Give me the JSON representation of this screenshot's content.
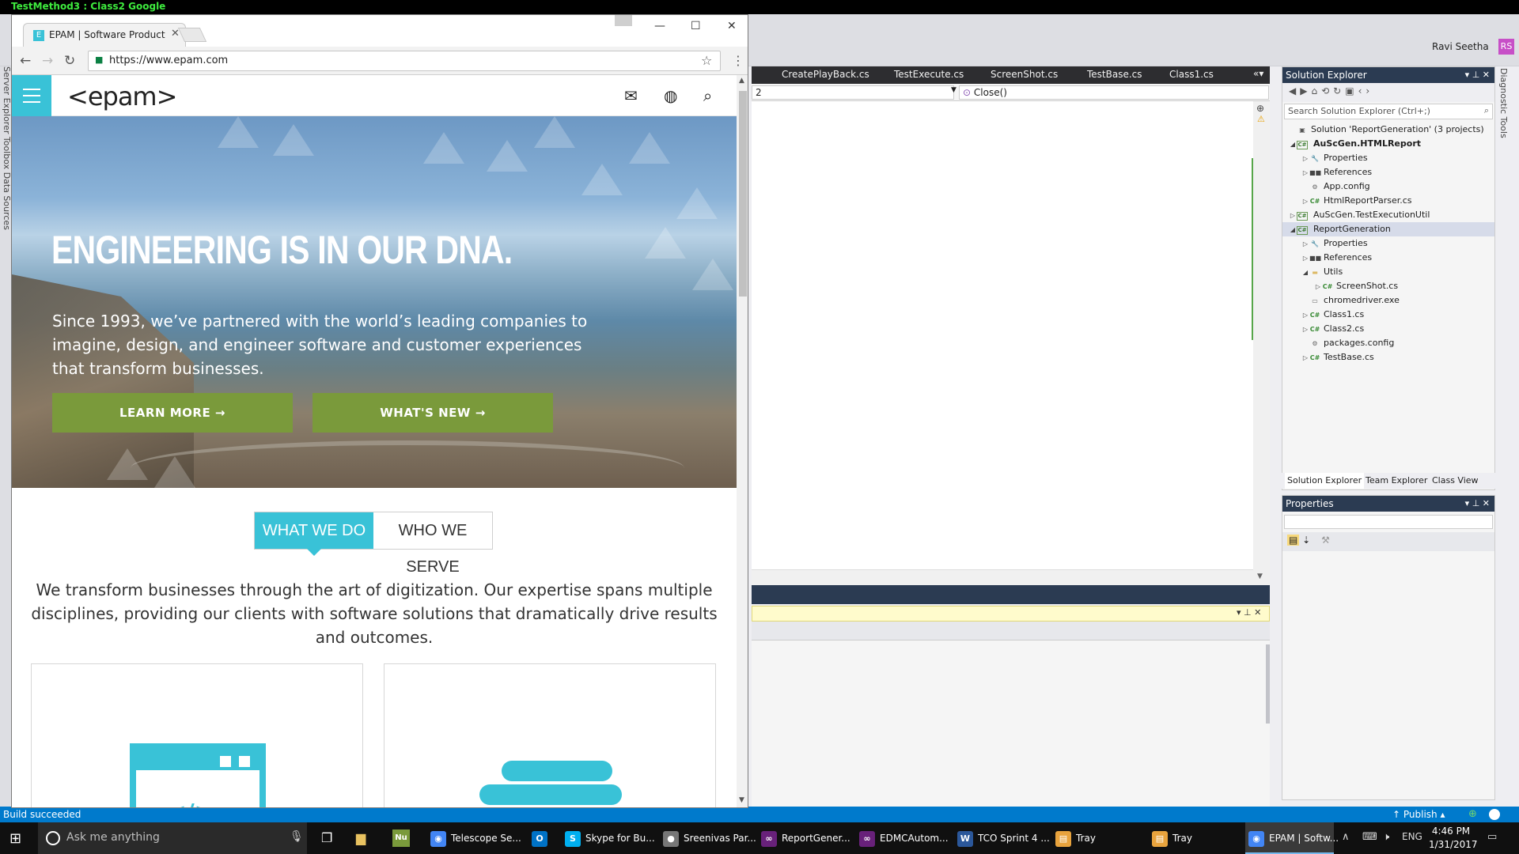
{
  "vs": {
    "title": "TestMethod3 : Class2 Google",
    "user_name": "Ravi Seetha",
    "user_initials": "RS",
    "doc_tabs": [
      "CreatePlayBack.cs",
      "TestExecute.cs",
      "ScreenShot.cs",
      "TestBase.cs",
      "Class1.cs"
    ],
    "nav_left": "2",
    "nav_right": "Close()",
    "left_strip": "Server Explorer   Toolbox   Data Sources",
    "diag_tools": "Diagnostic Tools",
    "status": "Build succeeded",
    "publish": "Publish",
    "solution_explorer": {
      "title": "Solution Explorer",
      "search_placeholder": "Search Solution Explorer (Ctrl+;)",
      "tree": [
        {
          "label": "Solution 'ReportGeneration' (3 projects)",
          "depth": 0,
          "icon": "solution-icon",
          "expander": "",
          "bold": false
        },
        {
          "label": "AuScGen.HTMLReport",
          "depth": 0,
          "icon": "csharp-project-icon",
          "expander": "expanded",
          "bold": true
        },
        {
          "label": "Properties",
          "depth": 1,
          "icon": "wrench-icon",
          "expander": "collapsed",
          "bold": false
        },
        {
          "label": "References",
          "depth": 1,
          "icon": "references-icon",
          "expander": "collapsed",
          "bold": false
        },
        {
          "label": "App.config",
          "depth": 1,
          "icon": "config-icon",
          "expander": "",
          "bold": false
        },
        {
          "label": "HtmlReportParser.cs",
          "depth": 1,
          "icon": "csharp-file-icon",
          "expander": "collapsed",
          "bold": false
        },
        {
          "label": "AuScGen.TestExecutionUtil",
          "depth": 0,
          "icon": "csharp-project-icon",
          "expander": "collapsed",
          "bold": false
        },
        {
          "label": "ReportGeneration",
          "depth": 0,
          "icon": "csharp-project-icon",
          "expander": "expanded",
          "bold": false,
          "selected": true
        },
        {
          "label": "Properties",
          "depth": 1,
          "icon": "wrench-icon",
          "expander": "collapsed",
          "bold": false
        },
        {
          "label": "References",
          "depth": 1,
          "icon": "references-icon",
          "expander": "collapsed",
          "bold": false
        },
        {
          "label": "Utils",
          "depth": 1,
          "icon": "folder-icon",
          "expander": "expanded",
          "bold": false
        },
        {
          "label": "ScreenShot.cs",
          "depth": 2,
          "icon": "csharp-file-icon",
          "expander": "collapsed",
          "bold": false
        },
        {
          "label": "chromedriver.exe",
          "depth": 1,
          "icon": "exe-icon",
          "expander": "",
          "bold": false
        },
        {
          "label": "Class1.cs",
          "depth": 1,
          "icon": "csharp-file-icon",
          "expander": "collapsed",
          "bold": false
        },
        {
          "label": "Class2.cs",
          "depth": 1,
          "icon": "csharp-file-icon",
          "expander": "collapsed",
          "bold": false
        },
        {
          "label": "packages.config",
          "depth": 1,
          "icon": "config-icon",
          "expander": "",
          "bold": false
        },
        {
          "label": "TestBase.cs",
          "depth": 1,
          "icon": "csharp-file-icon",
          "expander": "collapsed",
          "bold": false
        }
      ],
      "tabs": [
        "Solution Explorer",
        "Team Explorer",
        "Class View"
      ]
    },
    "properties": {
      "title": "Properties"
    }
  },
  "chrome": {
    "tab_title": "EPAM | Software Product",
    "url": "https://www.epam.com",
    "favicon_letter": "E"
  },
  "site": {
    "logo": "<epam>",
    "hero_title": "ENGINEERING IS IN OUR DNA.",
    "hero_sub": "Since 1993, we’ve partnered with the world’s leading companies to imagine, design, and engineer software and customer experiences that transform businesses.",
    "learn_more": "LEARN MORE  →",
    "whats_new": "WHAT'S NEW  →",
    "tab_what": "WHAT WE DO",
    "tab_who": "WHO WE SERVE",
    "intro": "We transform businesses through the art of digitization. Our expertise spans multiple disciplines, providing our clients with software solutions that dramatically drive results and outcomes."
  },
  "taskbar": {
    "search_placeholder": "Ask me anything",
    "apps": [
      {
        "label": "Telescope Se...",
        "icon": "chrome-icon",
        "color": "#4285f4",
        "active": false
      },
      {
        "label": "",
        "icon": "outlook-icon",
        "color": "#0072c6",
        "active": false
      },
      {
        "label": "Skype for Bu...",
        "icon": "skype-icon",
        "color": "#00aff0",
        "active": false
      },
      {
        "label": "Sreenivas Par...",
        "icon": "chat-icon",
        "color": "#777777",
        "active": false
      },
      {
        "label": "ReportGener...",
        "icon": "visual-studio-icon",
        "color": "#68217a",
        "active": false
      },
      {
        "label": "EDMCAutom...",
        "icon": "visual-studio-icon",
        "color": "#68217a",
        "active": false
      },
      {
        "label": "TCO Sprint 4 ...",
        "icon": "word-icon",
        "color": "#2b579a",
        "active": false
      },
      {
        "label": "Tray",
        "icon": "tray-app-icon",
        "color": "#e8a33d",
        "active": false
      },
      {
        "label": "Tray",
        "icon": "tray-app-icon",
        "color": "#e8a33d",
        "active": false
      },
      {
        "label": "EPAM | Softw...",
        "icon": "chrome-icon",
        "color": "#4285f4",
        "active": true
      }
    ],
    "lang": "ENG",
    "time": "4:46 PM",
    "date": "1/31/2017"
  }
}
